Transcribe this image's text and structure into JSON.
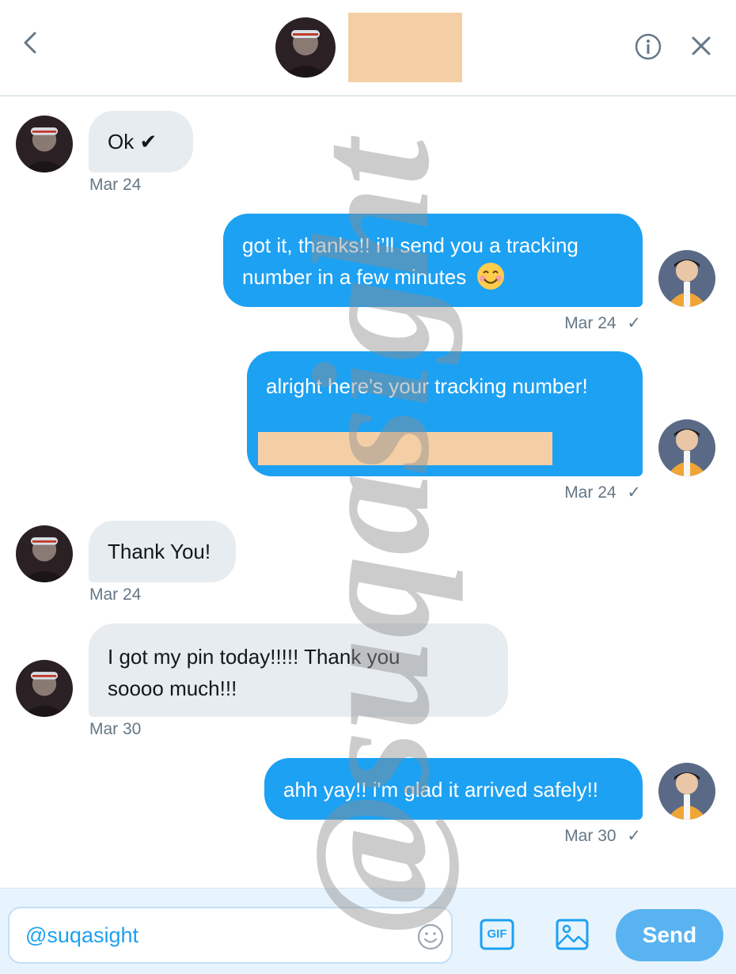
{
  "header": {
    "back_icon": "chevron-left-icon",
    "info_icon": "info-icon",
    "close_icon": "close-icon"
  },
  "messages": [
    {
      "direction": "in",
      "text": "Ok ✔",
      "timestamp": "Mar 24"
    },
    {
      "direction": "out",
      "line1": "got it, thanks!! i’ll send you a tracking",
      "line2": "number in a few minutes",
      "emoji": "smiling-face-icon",
      "timestamp": "Mar 24",
      "status": "✓"
    },
    {
      "direction": "out",
      "text": "alright here's your tracking number!",
      "timestamp": "Mar 24",
      "status": "✓"
    },
    {
      "direction": "in",
      "text": "Thank You!",
      "timestamp": "Mar 24"
    },
    {
      "direction": "in",
      "line1": "I got my pin today!!!!! Thank you",
      "line2": "soooo much!!!",
      "timestamp": "Mar 30"
    },
    {
      "direction": "out",
      "text": "ahh yay!! i'm glad it arrived safely!!",
      "timestamp": "Mar 30",
      "status": "✓"
    }
  ],
  "composer": {
    "input_value": "@suqasight",
    "gif_label": "GIF",
    "send_label": "Send"
  },
  "watermark": {
    "text": "@suqasight"
  },
  "colors": {
    "accent": "#1da1f2",
    "incoming_bubble": "#e6ecf0",
    "redaction": "#f4cfa6",
    "composer_bg": "#e8f4fd"
  }
}
